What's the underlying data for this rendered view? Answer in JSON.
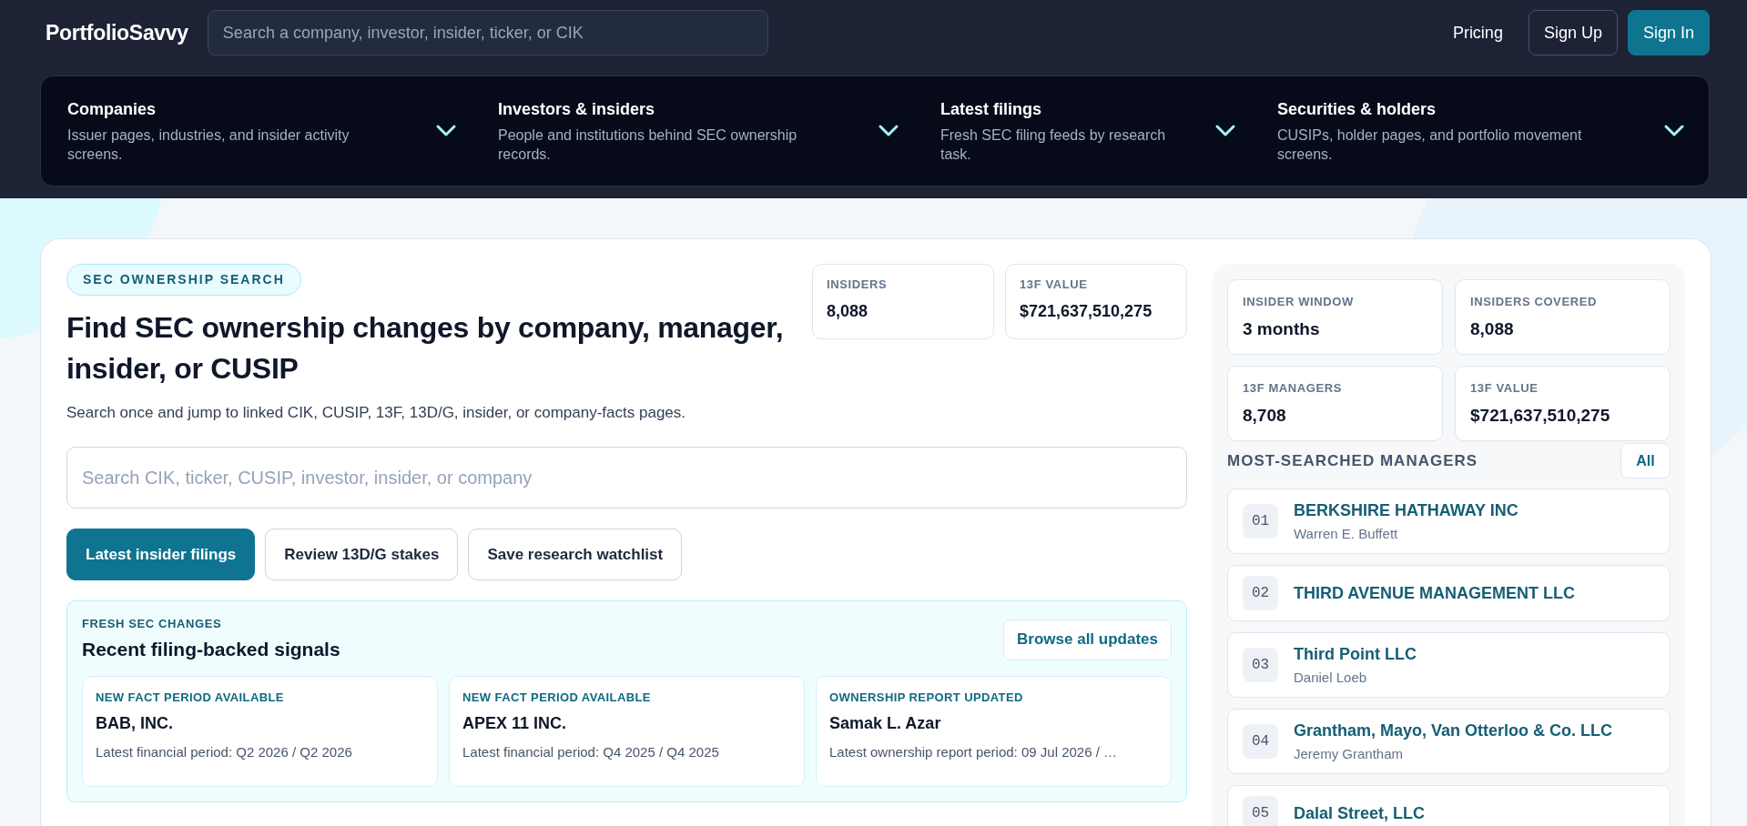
{
  "header": {
    "logo": "PortfolioSavvy",
    "search": {
      "placeholder": "Search a company, investor, insider, ticker, or CIK"
    },
    "actions": [
      {
        "label": "Pricing",
        "kind": "link"
      },
      {
        "label": "Sign Up",
        "kind": "outline"
      },
      {
        "label": "Sign In",
        "kind": "primary"
      }
    ]
  },
  "nav": [
    {
      "title": "Companies",
      "description": "Issuer pages, industries, and insider activity screens.",
      "expanded": false
    },
    {
      "title": "Investors & insiders",
      "description": "People and institutions behind SEC ownership records.",
      "expanded": false
    },
    {
      "title": "Latest filings",
      "description": "Fresh SEC filing feeds by research task.",
      "expanded": false
    },
    {
      "title": "Securities & holders",
      "description": "CUSIPs, holder pages, and portfolio movement screens.",
      "expanded": false
    }
  ],
  "hero": {
    "eyebrow": "SEC OWNERSHIP SEARCH",
    "title": "Find SEC ownership changes by company, manager, insider, or CUSIP",
    "subtitle": "Search once and jump to linked CIK, CUSIP, 13F, 13D/G, insider, or company-facts pages.",
    "stats": [
      {
        "label": "INSIDERS",
        "value": "8,088"
      },
      {
        "label": "13F VALUE",
        "value": "$721,637,510,275"
      }
    ],
    "search": {
      "placeholder": "Search CIK, ticker, CUSIP, investor, insider, or company"
    },
    "actions": [
      {
        "label": "Latest insider filings",
        "kind": "primary"
      },
      {
        "label": "Review 13D/G stakes",
        "kind": "outline"
      },
      {
        "label": "Save research watchlist",
        "kind": "outline"
      }
    ]
  },
  "fresh_changes": {
    "eyebrow": "FRESH SEC CHANGES",
    "title": "Recent filing-backed signals",
    "action": "Browse all updates",
    "cards": [
      {
        "tag": "NEW FACT PERIOD AVAILABLE",
        "name": "BAB, INC.",
        "detail": "Latest financial period: Q2 2026 / Q2 2026"
      },
      {
        "tag": "NEW FACT PERIOD AVAILABLE",
        "name": "APEX 11 INC.",
        "detail": "Latest financial period: Q4 2025 / Q4 2025"
      },
      {
        "tag": "OWNERSHIP REPORT UPDATED",
        "name": "Samak L. Azar",
        "detail": "Latest ownership report period: 09 Jul 2026 / …"
      }
    ]
  },
  "sidebar": {
    "stats": [
      {
        "label": "INSIDER WINDOW",
        "value": "3 months"
      },
      {
        "label": "INSIDERS COVERED",
        "value": "8,088"
      },
      {
        "label": "13F MANAGERS",
        "value": "8,708"
      },
      {
        "label": "13F VALUE",
        "value": "$721,637,510,275"
      }
    ],
    "heading": "MOST-SEARCHED MANAGERS",
    "action": "All",
    "managers": [
      {
        "rank": "01",
        "name": "BERKSHIRE HATHAWAY INC",
        "person": "Warren E. Buffett"
      },
      {
        "rank": "02",
        "name": "THIRD AVENUE MANAGEMENT LLC"
      },
      {
        "rank": "03",
        "name": "Third Point LLC",
        "person": "Daniel Loeb"
      },
      {
        "rank": "04",
        "name": "Grantham, Mayo, Van Otterloo & Co. LLC",
        "person": "Jeremy Grantham"
      },
      {
        "rank": "05",
        "name": "Dalal Street, LLC"
      }
    ]
  }
}
